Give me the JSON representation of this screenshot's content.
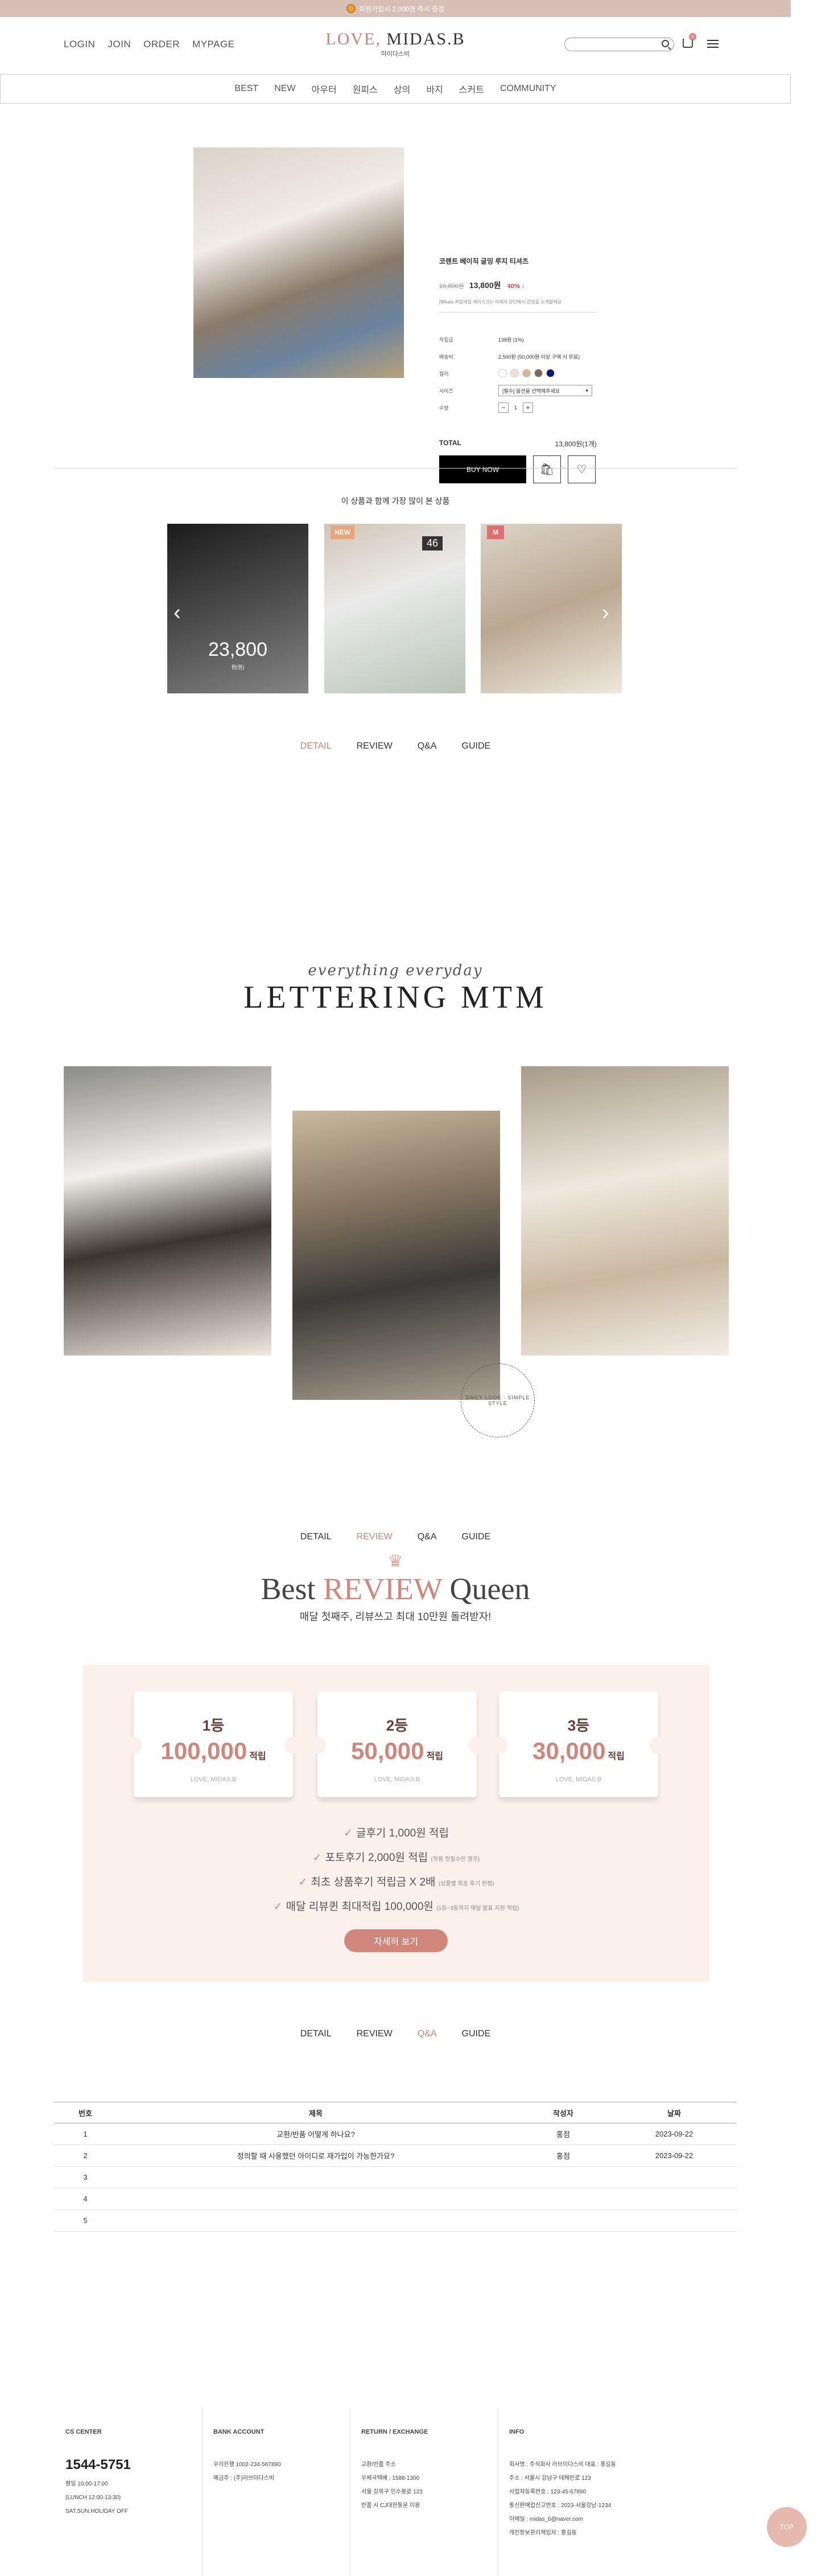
{
  "topbar": {
    "text": "회원가입시 2,000원 즉시 증정"
  },
  "header": {
    "nav": [
      "LOGIN",
      "JOIN",
      "ORDER",
      "MYPAGE"
    ],
    "logo_love": "LOVE,",
    "logo_name": "MIDAS.B",
    "logo_sub": "마이다스비",
    "cart_count": "0"
  },
  "categories": [
    "BEST",
    "NEW",
    "아우터",
    "원피스",
    "상의",
    "바지",
    "스커트",
    "COMMUNITY"
  ],
  "product": {
    "name": "코렌트 베이직 굴밍 루지 티셔츠",
    "old_price": "19,800원",
    "price": "13,800원",
    "discount": "40%",
    "discount_arrow": "↓",
    "note": "[Mikala 피팅테일 게이스크]> 이태리 원단에서 감정을 소개할께요",
    "rows": [
      {
        "k": "적립금",
        "v": "138원 (1%)"
      },
      {
        "k": "배송비",
        "v": "2,500원 (50,000원 이상 구매 시 무료)"
      },
      {
        "k": "컬러",
        "v": ""
      },
      {
        "k": "사이즈",
        "v": "[필수] 옵션을 선택해주세요"
      },
      {
        "k": "수량",
        "v": "1"
      }
    ],
    "swatches": [
      "#ffffff",
      "#f0e0d4",
      "#d6b590",
      "#7a6a5c",
      "#0b1a6a"
    ],
    "total_label": "TOTAL",
    "total_value": "13,800원(1개)",
    "buy_label": "BUY NOW"
  },
  "related": {
    "title": "이 상품과 함께 가장 많이 본 상품",
    "price": "23,800",
    "price_sub": "원(원)",
    "tags": [
      "",
      "NEW",
      "M"
    ],
    "card2_num": "46"
  },
  "tabs": [
    "DETAIL",
    "REVIEW",
    "Q&A",
    "GUIDE"
  ],
  "lettering": {
    "script": "everything everyday",
    "big": "LETTERING MTM"
  },
  "sticker_text": "DAILY LOOK · SIMPLE STYLE",
  "review": {
    "title_a": "Best",
    "title_b": "REVIEW",
    "title_c": "Queen",
    "subtitle": "매달 첫째주, 리뷰쓰고 최대 10만원 돌려받자!",
    "coupons": [
      {
        "rank": "1등",
        "amount": "100,000",
        "unit": "적립"
      },
      {
        "rank": "2등",
        "amount": "50,000",
        "unit": "적립"
      },
      {
        "rank": "3등",
        "amount": "30,000",
        "unit": "적립"
      }
    ],
    "coupon_brand": "LOVE, MIDAS.B",
    "benefits": [
      {
        "main": "글후기 1,000원 적립",
        "small": ""
      },
      {
        "main": "포토후기 2,000원 적립",
        "small": "(착용 컷필수인 경우)"
      },
      {
        "main": "최초 상품후기 적립금 X 2배",
        "small": "(상품별 최초 후기 한정)"
      },
      {
        "main": "매달 리뷰퀸 최대적립 100,000원",
        "small": "(1등~3등까지 매달 발표 지원 적립)"
      }
    ],
    "more": "자세히 보기"
  },
  "qa": {
    "headers": [
      "번호",
      "제목",
      "작성자",
      "날짜"
    ],
    "rows": [
      [
        "1",
        "교환/반품 어떻게 하나요?",
        "홍점",
        "2023-09-22"
      ],
      [
        "2",
        "정의할 때 사용했던 아이디로 재가입이 가능한가요?",
        "홍점",
        "2023-09-22"
      ],
      [
        "3",
        "",
        "",
        ""
      ],
      [
        "4",
        "",
        "",
        ""
      ],
      [
        "5",
        "",
        "",
        ""
      ]
    ]
  },
  "footer": {
    "cs_title": "CS CENTER",
    "tel": "1544-5751",
    "cs_lines": [
      "평일 10:00-17:00",
      "(LUNCH 12:00-13:30)",
      "SAT.SUN.HOLIDAY OFF"
    ],
    "bank_title": "BANK ACCOUNT",
    "bank_lines": [
      "우리은행 1002-234-567890",
      "예금주 : (주)러브미다스비"
    ],
    "return_title": "RETURN / EXCHANGE",
    "return_lines": [
      "교환/반품 주소",
      "우체국택배 : 1588-1300",
      "서울 강북구 인수봉로 123",
      "반품 시 CJ대한통운 이용"
    ],
    "info_title": "INFO",
    "info_lines": [
      "회사명 : 주식회사 러브미다스비 대표 : 홍길동",
      "주소 : 서울시 강남구 테헤란로 123",
      "사업자등록번호 : 123-45-67890",
      "통신판매업신고번호 : 2023-서울강남-1234",
      "이메일 : midas_b@naver.com",
      "개인정보관리책임자 : 홍길동"
    ],
    "top": "TOP"
  }
}
